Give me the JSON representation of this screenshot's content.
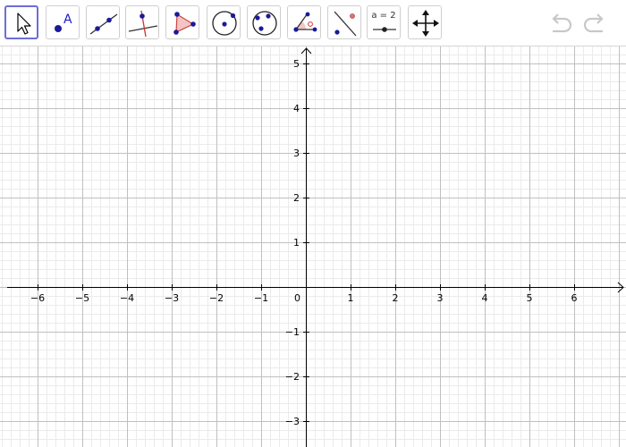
{
  "toolbar": {
    "tools": [
      {
        "id": "move",
        "name": "move-tool-button",
        "icon": "arrow-pointer-icon",
        "selected": true
      },
      {
        "id": "point",
        "name": "point-tool-button",
        "icon": "point-icon",
        "label": "A"
      },
      {
        "id": "line",
        "name": "line-tool-button",
        "icon": "line-through-two-points-icon"
      },
      {
        "id": "perpendicular",
        "name": "perpendicular-line-tool-button",
        "icon": "perpendicular-line-icon"
      },
      {
        "id": "polygon",
        "name": "polygon-tool-button",
        "icon": "polygon-icon"
      },
      {
        "id": "circle",
        "name": "circle-center-point-tool-button",
        "icon": "circle-center-point-icon"
      },
      {
        "id": "circle3",
        "name": "circle-three-points-tool-button",
        "icon": "circle-three-points-icon"
      },
      {
        "id": "angle",
        "name": "angle-tool-button",
        "icon": "angle-icon"
      },
      {
        "id": "reflect",
        "name": "reflect-about-line-tool-button",
        "icon": "reflect-about-line-icon"
      },
      {
        "id": "slider",
        "name": "slider-tool-button",
        "icon": "slider-icon",
        "label": "a = 2"
      },
      {
        "id": "move-view",
        "name": "move-graphics-view-tool-button",
        "icon": "move-arrows-icon"
      }
    ],
    "undo_icon": "undo-icon",
    "redo_icon": "redo-icon"
  },
  "colors": {
    "point": "#1a1a99",
    "polygon_fill": "#f2c4c4",
    "polygon_stroke": "#cc4444",
    "grid_major": "#c0c0c0",
    "grid_minor": "#ebebeb",
    "axis": "#000000",
    "selected_border": "#6d6dd8",
    "disabled_icon": "#c8c8c8"
  },
  "axes": {
    "x_ticks": [
      "−6",
      "−5",
      "−4",
      "−3",
      "−2",
      "−1",
      "0",
      "1",
      "2",
      "3",
      "4",
      "5",
      "6"
    ],
    "y_ticks": [
      "5",
      "4",
      "3",
      "2",
      "1",
      "−1",
      "−2",
      "−3"
    ],
    "x_tick_values": [
      -6,
      -5,
      -4,
      -3,
      -2,
      -1,
      0,
      1,
      2,
      3,
      4,
      5,
      6
    ],
    "y_tick_values": [
      5,
      4,
      3,
      2,
      1,
      -1,
      -2,
      -3
    ],
    "grid": true,
    "minor_per_major": 5
  }
}
